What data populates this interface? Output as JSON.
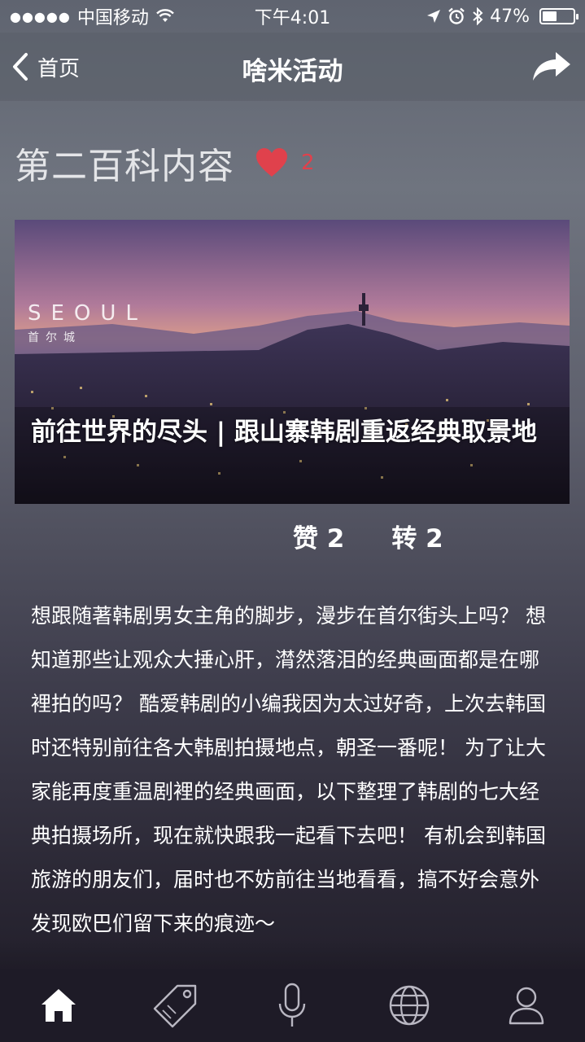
{
  "status_bar": {
    "signal": "●●●●●",
    "carrier": "中国移动",
    "time": "下午4:01",
    "battery_percent": "47%",
    "battery_level": 0.47
  },
  "nav": {
    "back_label": "首页",
    "title": "啥米活动"
  },
  "headline": {
    "title": "第二百科内容",
    "likes": "2"
  },
  "banner": {
    "logo_word": "SEOUL",
    "logo_sub": "首尔城",
    "caption": "前往世界的尽头 | 跟山寨韩剧重返经典取景地"
  },
  "stats": {
    "likes_label": "赞 2",
    "shares_label": "转 2"
  },
  "article": {
    "body": "想跟随著韩剧男女主角的脚步，漫步在首尔街头上吗？ 想知道那些让观众大捶心肝，潸然落泪的经典画面都是在哪裡拍的吗？ 酷爱韩剧的小编我因为太过好奇，上次去韩国时还特别前往各大韩剧拍摄地点，朝圣一番呢！ 为了让大家能再度重温剧裡的经典画面，以下整理了韩剧的七大经典拍摄场所，现在就快跟我一起看下去吧！ 有机会到韩国旅游的朋友们，届时也不妨前往当地看看，搞不好会意外发现欧巴们留下来的痕迹～"
  },
  "tabs": [
    {
      "icon": "home-icon",
      "active": true
    },
    {
      "icon": "tag-icon",
      "active": false
    },
    {
      "icon": "microphone-icon",
      "active": false
    },
    {
      "icon": "globe-icon",
      "active": false
    },
    {
      "icon": "user-icon",
      "active": false
    }
  ],
  "colors": {
    "accent_heart": "#e0414c",
    "tab_bar": "#1e1b27"
  }
}
